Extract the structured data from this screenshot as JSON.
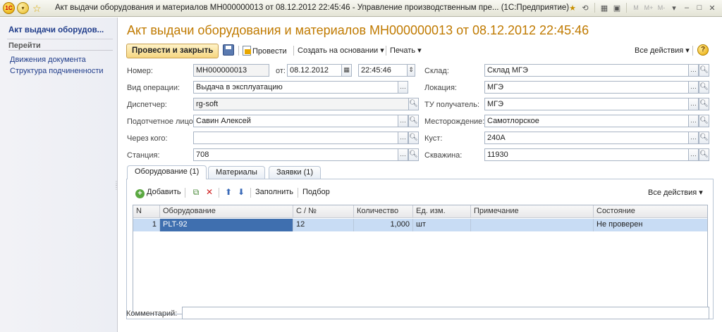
{
  "window": {
    "logo": "1С",
    "title": "Акт выдачи оборудования и материалов МН000000013 от 08.12.2012 22:45:46 - Управление производственным пре... (1С:Предприятие)",
    "toolbar_right": [
      "M",
      "M+",
      "M-"
    ]
  },
  "sidebar": {
    "title": "Акт выдачи оборудов...",
    "section_label": "Перейти",
    "items": [
      {
        "label": "Движения документа"
      },
      {
        "label": "Структура подчиненности"
      }
    ]
  },
  "document": {
    "title": "Акт выдачи оборудования и материалов МН000000013 от 08.12.2012 22:45:46"
  },
  "commands": {
    "post_close": "Провести и закрыть",
    "post": "Провести",
    "create_based_on": "Создать на основании",
    "print": "Печать",
    "all_actions": "Все действия"
  },
  "fields": {
    "number": {
      "label": "Номер:",
      "value": "МН000000013"
    },
    "date_label": "от:",
    "date": "08.12.2012",
    "time": "22:45:46",
    "operation": {
      "label": "Вид операции:",
      "value": "Выдача в эксплуатацию"
    },
    "dispatcher": {
      "label": "Диспетчер:",
      "value": "rg-soft"
    },
    "accountable": {
      "label": "Подотчетное лицо:",
      "value": "Савин Алексей"
    },
    "via_whom": {
      "label": "Через кого:",
      "value": ""
    },
    "station": {
      "label": "Станция:",
      "value": "708"
    },
    "warehouse": {
      "label": "Склад:",
      "value": "Склад МГЭ"
    },
    "location": {
      "label": "Локация:",
      "value": "МГЭ"
    },
    "tu_receiver": {
      "label": "ТУ получатель:",
      "value": "МГЭ"
    },
    "field": {
      "label": "Месторождение:",
      "value": "Самотлорское"
    },
    "pad": {
      "label": "Куст:",
      "value": "240А"
    },
    "well": {
      "label": "Скважина:",
      "value": "11930"
    }
  },
  "tabs": [
    {
      "label": "Оборудование (1)",
      "active": true
    },
    {
      "label": "Материалы",
      "active": false
    },
    {
      "label": "Заявки (1)",
      "active": false
    }
  ],
  "table_commands": {
    "add": "Добавить",
    "fill": "Заполнить",
    "select": "Подбор",
    "all_actions": "Все действия"
  },
  "table": {
    "columns": [
      "N",
      "Оборудование",
      "С / №",
      "Количество",
      "Ед. изм.",
      "Примечание",
      "Состояние"
    ],
    "rows": [
      {
        "n": "1",
        "equipment": "PLT-92",
        "serial": "12",
        "qty": "1,000",
        "unit": "шт",
        "note": "",
        "state": "Не проверен"
      }
    ]
  },
  "comment": {
    "label": "Комментарий:",
    "value": ""
  }
}
